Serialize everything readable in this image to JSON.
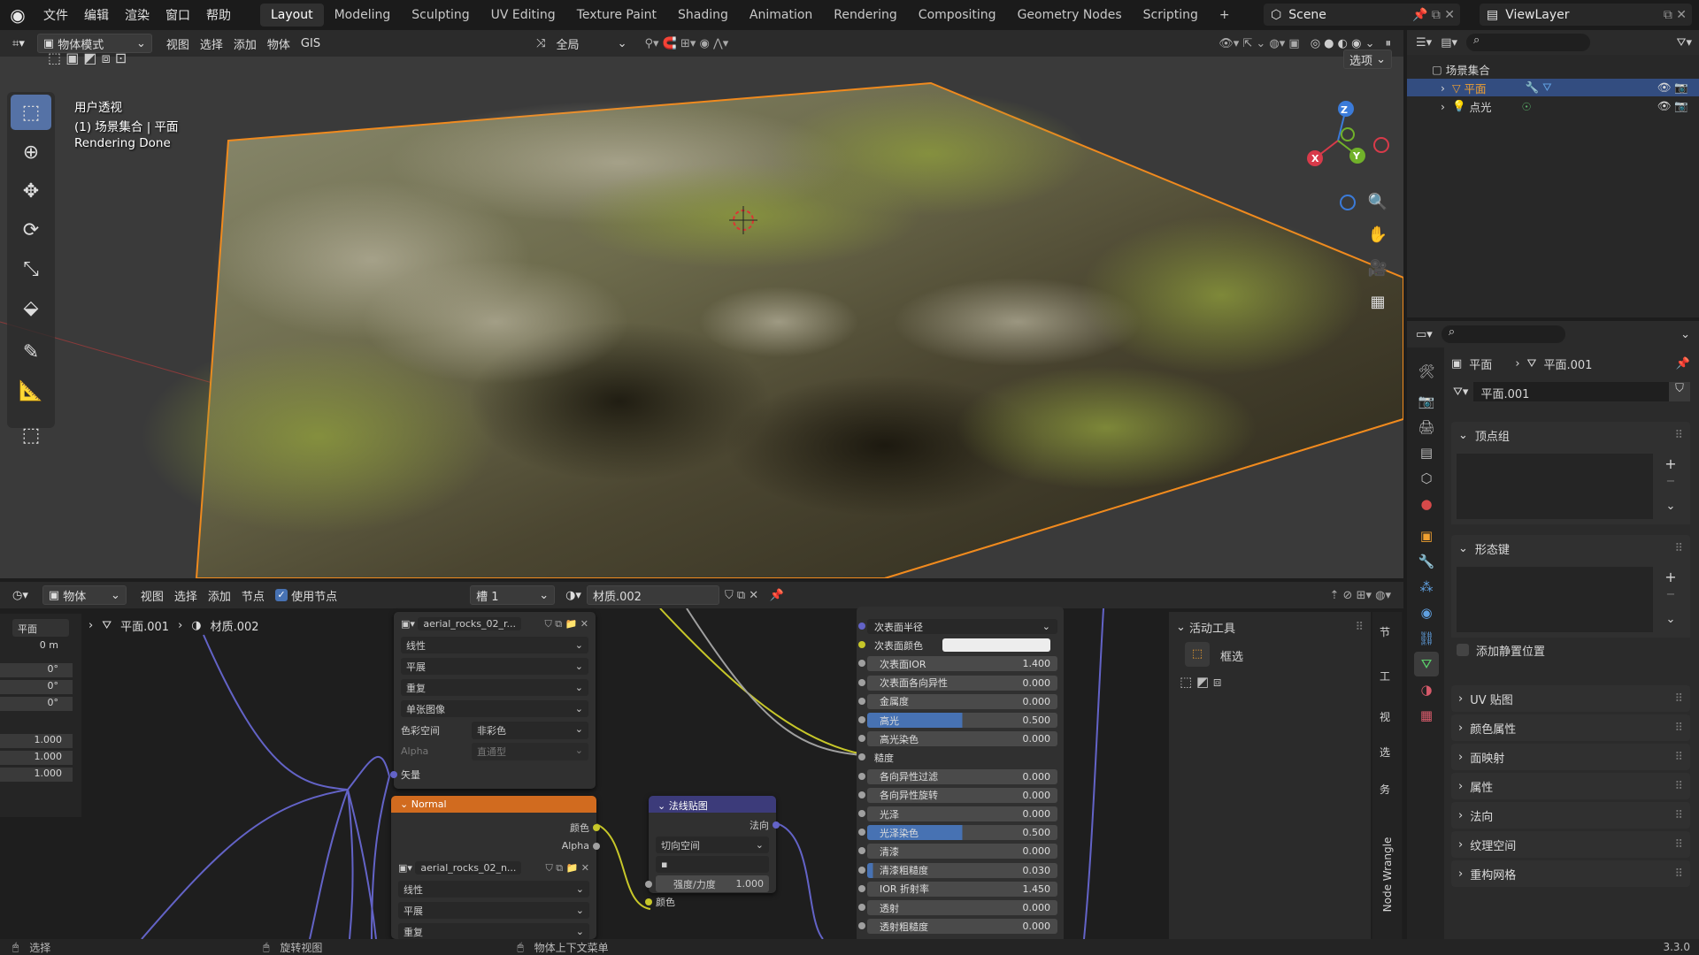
{
  "topbar": {
    "menus": [
      "文件",
      "编辑",
      "渲染",
      "窗口",
      "帮助"
    ],
    "workspaces": [
      "Layout",
      "Modeling",
      "Sculpting",
      "UV Editing",
      "Texture Paint",
      "Shading",
      "Animation",
      "Rendering",
      "Compositing",
      "Geometry Nodes",
      "Scripting"
    ],
    "active_workspace": "Layout",
    "scene": "Scene",
    "view_layer": "ViewLayer"
  },
  "viewport": {
    "mode": "物体模式",
    "menus": [
      "视图",
      "选择",
      "添加",
      "物体",
      "GIS"
    ],
    "transform": "全局",
    "options": "选项",
    "overlay": {
      "view": "用户透视",
      "collection": "(1) 场景集合 | 平面",
      "status": "Rendering Done"
    },
    "gizmo": {
      "x": "X",
      "y": "Y",
      "z": "Z"
    }
  },
  "node_editor": {
    "type": "物体",
    "menus": [
      "视图",
      "选择",
      "添加",
      "节点"
    ],
    "use_nodes": "使用节点",
    "slot": "槽 1",
    "material": "材质.002",
    "breadcrumb": {
      "object": "平面",
      "mesh": "平面.001",
      "material": "材质.002"
    },
    "side_values": [
      "0 m",
      "0°",
      "0°",
      "0°",
      "1.000",
      "1.000",
      "1.000"
    ],
    "tex1": {
      "name": "aerial_rocks_02_r...",
      "interp": "线性",
      "proj": "平展",
      "ext": "重复",
      "src": "单张图像",
      "cs_label": "色彩空间",
      "cs_val": "非彩色",
      "alpha_label": "Alpha",
      "alpha_val": "直通型",
      "vec": "矢量"
    },
    "tex2": {
      "title": "Normal",
      "out_color": "颜色",
      "out_alpha": "Alpha",
      "name": "aerial_rocks_02_n...",
      "interp": "线性",
      "proj": "平展",
      "ext": "重复"
    },
    "normalmap": {
      "title": "法线贴图",
      "out": "法向",
      "space": "切向空间",
      "strength_label": "强度/力度",
      "strength": "1.000",
      "in_color": "颜色"
    },
    "bsdf_rows": [
      {
        "label": "次表面半径",
        "value": "",
        "kind": "drop"
      },
      {
        "label": "次表面颜色",
        "value": "",
        "kind": "color"
      },
      {
        "label": "次表面IOR",
        "value": "1.400",
        "kind": "field",
        "fill": 0
      },
      {
        "label": "次表面各向异性",
        "value": "0.000",
        "kind": "field",
        "fill": 0
      },
      {
        "label": "金属度",
        "value": "0.000",
        "kind": "field",
        "fill": 0
      },
      {
        "label": "高光",
        "value": "0.500",
        "kind": "field",
        "fill": 0.5
      },
      {
        "label": "高光染色",
        "value": "0.000",
        "kind": "field",
        "fill": 0
      },
      {
        "label": "糙度",
        "value": "",
        "kind": "socket"
      },
      {
        "label": "各向异性过滤",
        "value": "0.000",
        "kind": "field",
        "fill": 0
      },
      {
        "label": "各向异性旋转",
        "value": "0.000",
        "kind": "field",
        "fill": 0
      },
      {
        "label": "光泽",
        "value": "0.000",
        "kind": "field",
        "fill": 0
      },
      {
        "label": "光泽染色",
        "value": "0.500",
        "kind": "field",
        "fill": 0.5
      },
      {
        "label": "清漆",
        "value": "0.000",
        "kind": "field",
        "fill": 0
      },
      {
        "label": "清漆粗糙度",
        "value": "0.030",
        "kind": "field",
        "fill": 0.03
      },
      {
        "label": "IOR 折射率",
        "value": "1.450",
        "kind": "field",
        "fill": 0
      },
      {
        "label": "透射",
        "value": "0.000",
        "kind": "field",
        "fill": 0
      },
      {
        "label": "透射粗糙度",
        "value": "0.000",
        "kind": "field",
        "fill": 0
      }
    ],
    "active_tool": {
      "title": "活动工具",
      "tool": "框选"
    },
    "side_tabs": [
      "节",
      "工",
      "视",
      "选",
      "务"
    ],
    "node_wrangle": "Node Wrangle"
  },
  "outliner": {
    "root": "场景集合",
    "items": [
      "平面",
      "点光"
    ]
  },
  "properties": {
    "object": "平面",
    "mesh": "平面.001",
    "mesh_field": "平面.001",
    "sections_open": [
      "顶点组",
      "形态键"
    ],
    "rest_pos": "添加静置位置",
    "sections": [
      "UV 贴图",
      "颜色属性",
      "面映射",
      "属性",
      "法向",
      "纹理空间",
      "重构网格"
    ]
  },
  "status": {
    "select": "选择",
    "rotate": "旋转视图",
    "context": "物体上下文菜单",
    "version": "3.3.0"
  }
}
